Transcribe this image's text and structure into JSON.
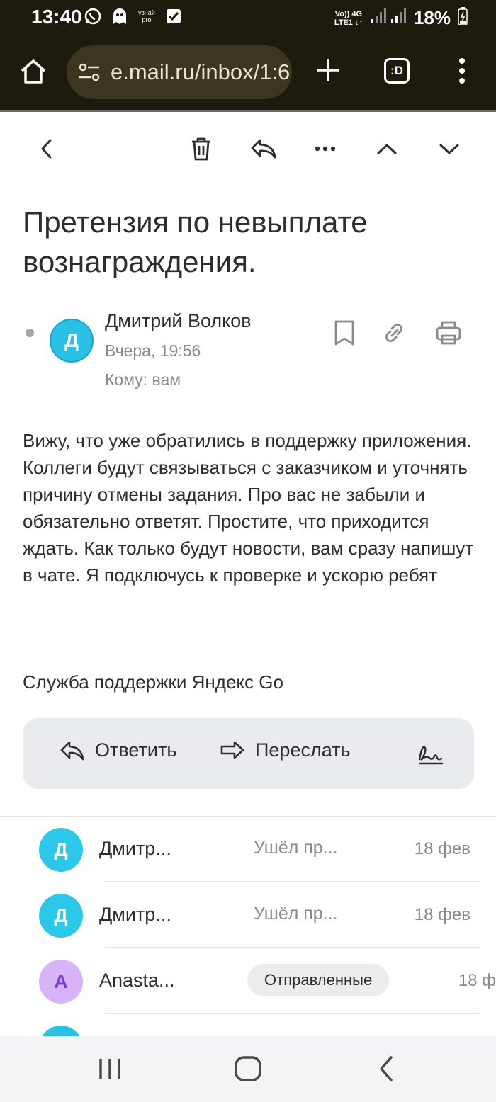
{
  "status_bar": {
    "time": "13:40",
    "notif_icons": [
      "whatsapp-icon",
      "ghost-icon",
      "uznai-pro-icon",
      "checkbox-icon"
    ],
    "uznai_text": "узнай pro",
    "network_line1": "Vo)) 4G",
    "network_line2": "LTE1 ↓↑",
    "battery": "18%"
  },
  "browser": {
    "url": "e.mail.ru/inbox/1:6",
    "tabs_label": ":D"
  },
  "mail": {
    "subject": "Претензия по невыплате вознаграждения.",
    "sender": {
      "initial": "Д",
      "name": "Дмитрий Волков",
      "date": "Вчера, 19:56",
      "to": "Кому: вам"
    },
    "body": "Вижу, что уже обратились в поддержку приложения. Коллеги будут связываться с заказчиком и уточнять причину отмены задания. Про вас не забыли и обязательно ответят. Простите, что приходится ждать. Как только будут новости, вам сразу напишут в чате. Я подключусь к проверке и ускорю ребят",
    "signature": "Служба поддержки Яндекс Go"
  },
  "actions": {
    "reply": "Ответить",
    "forward": "Переслать"
  },
  "thread": [
    {
      "initial": "Д",
      "name": "Дмитр...",
      "snippet": "Ушёл пр...",
      "date": "18 фев",
      "color": "#2bc8ea"
    },
    {
      "initial": "Д",
      "name": "Дмитр...",
      "snippet": "Ушёл пр...",
      "date": "18 фев",
      "color": "#2bc8ea"
    },
    {
      "initial": "A",
      "name": "Anasta...",
      "folder": "Отправленные",
      "date": "18 ф",
      "color": "#d6b4f7"
    }
  ],
  "colors": {
    "browser_bg": "#1d1a0e",
    "avatar_blue": "#2bc0e6",
    "avatar_purple": "#d6b4f7",
    "reply_box_bg": "#e9ebef"
  }
}
